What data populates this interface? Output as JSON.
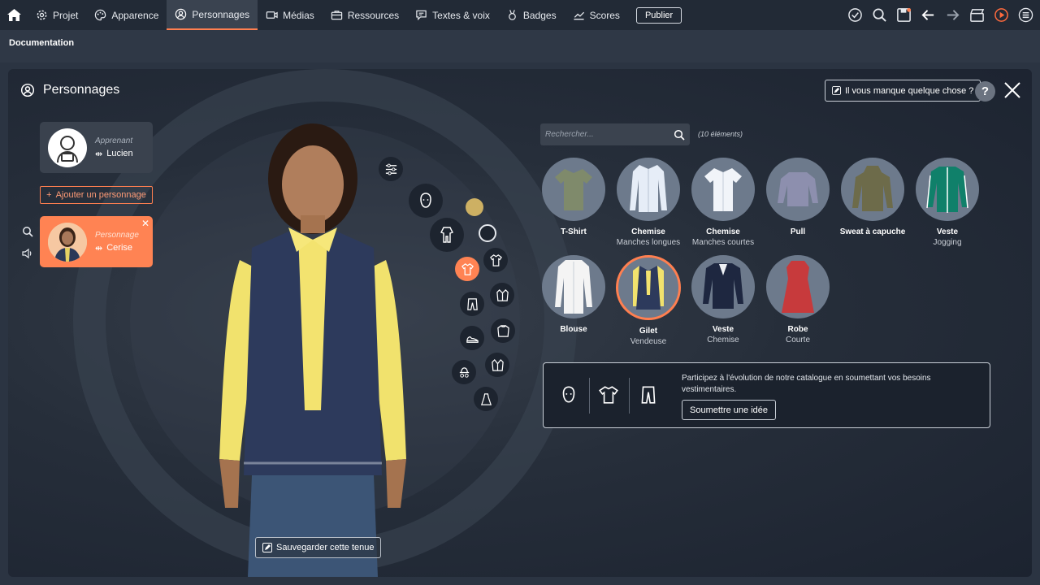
{
  "nav": {
    "items": [
      {
        "label": "Projet",
        "icon": "gear-icon"
      },
      {
        "label": "Apparence",
        "icon": "palette-icon"
      },
      {
        "label": "Personnages",
        "icon": "character-icon",
        "active": true
      },
      {
        "label": "Médias",
        "icon": "media-icon"
      },
      {
        "label": "Ressources",
        "icon": "briefcase-icon"
      },
      {
        "label": "Textes & voix",
        "icon": "speech-icon"
      },
      {
        "label": "Badges",
        "icon": "badge-icon"
      },
      {
        "label": "Scores",
        "icon": "chart-icon"
      }
    ],
    "publish_label": "Publier"
  },
  "subheader": {
    "title": "Documentation"
  },
  "panel": {
    "title": "Personnages",
    "missing_label": "Il vous manque quelque chose ?",
    "help_label": "?"
  },
  "characters": {
    "learner": {
      "role": "Apprenant",
      "name": "Lucien"
    },
    "add_label": "Ajouter un personnage",
    "selected": {
      "role": "Personnage",
      "name": "Cerise"
    }
  },
  "wardrobe": {
    "save_outfit_label": "Sauvegarder cette tenue",
    "skin_color": "#cdb063"
  },
  "catalog": {
    "search_placeholder": "Rechercher...",
    "count_label": "(10 éléments)",
    "items": [
      {
        "title": "T-Shirt",
        "subtitle": "",
        "color": "#7f8a6b"
      },
      {
        "title": "Chemise",
        "subtitle": "Manches longues",
        "color": "#e6edf7"
      },
      {
        "title": "Chemise",
        "subtitle": "Manches courtes",
        "color": "#f1f4f9"
      },
      {
        "title": "Pull",
        "subtitle": "",
        "color": "#8d8fae"
      },
      {
        "title": "Sweat à capuche",
        "subtitle": "",
        "color": "#6d6b4a"
      },
      {
        "title": "Veste",
        "subtitle": "Jogging",
        "color": "#10806a"
      },
      {
        "title": "Blouse",
        "subtitle": "",
        "color": "#f4f4f4"
      },
      {
        "title": "Gilet",
        "subtitle": "Vendeuse",
        "color": "#2d3a5c",
        "selected": true
      },
      {
        "title": "Veste",
        "subtitle": "Chemise",
        "color": "#1e2740"
      },
      {
        "title": "Robe",
        "subtitle": "Courte",
        "color": "#c73a3c"
      }
    ]
  },
  "suggest": {
    "text": "Participez à l'évolution de notre catalogue en soumettant vos besoins vestimentaires.",
    "button_label": "Soumettre une idée"
  }
}
